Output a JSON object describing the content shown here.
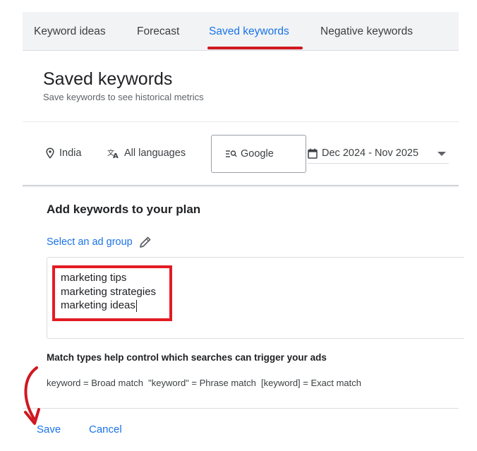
{
  "tabs": [
    {
      "label": "Keyword ideas",
      "active": false
    },
    {
      "label": "Forecast",
      "active": false
    },
    {
      "label": "Saved keywords",
      "active": true
    },
    {
      "label": "Negative keywords",
      "active": false
    }
  ],
  "header": {
    "title": "Saved keywords",
    "subtitle": "Save keywords to see historical metrics"
  },
  "filters": {
    "location": "India",
    "language": "All languages",
    "network": "Google",
    "date_range": "Dec 2024 - Nov 2025"
  },
  "add_keywords": {
    "title": "Add keywords to your plan",
    "select_ad_group": "Select an ad group",
    "keywords": [
      "marketing tips",
      "marketing strategies",
      "marketing ideas"
    ]
  },
  "match_types": {
    "title": "Match types help control which searches can trigger your ads",
    "description": "keyword = Broad match  \"keyword\" = Phrase match  [keyword] = Exact match"
  },
  "actions": {
    "save_label": "Save",
    "cancel_label": "Cancel"
  },
  "icons": {
    "location": "location-pin-icon",
    "language": "translate-icon",
    "network": "search-network-icon",
    "date": "calendar-icon",
    "edit": "pencil-icon",
    "dropdown": "caret-down-icon"
  },
  "colors": {
    "accent": "#1a73e8",
    "highlight": "#e31b23",
    "tab_bar": "#f1f3f4"
  }
}
